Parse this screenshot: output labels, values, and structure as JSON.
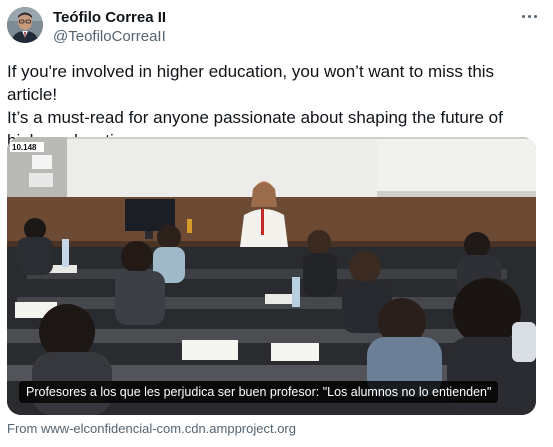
{
  "author": {
    "name": "Teófilo Correa II",
    "handle": "@TeofiloCorreaII"
  },
  "tweet": {
    "text": "If you're involved in higher education, you won’t want to miss this article!\nIt’s a must-read for anyone passionate about shaping the future of\nhigher education."
  },
  "link_card": {
    "headline": "Profesores a los que les perjudica ser buen profesor: \"Los alumnos no lo entienden\"",
    "image_sign_text": "10.148",
    "source": "From www-elconfidencial-com.cdn.ampproject.org"
  },
  "icons": {
    "more": "more-horizontal-icon"
  }
}
